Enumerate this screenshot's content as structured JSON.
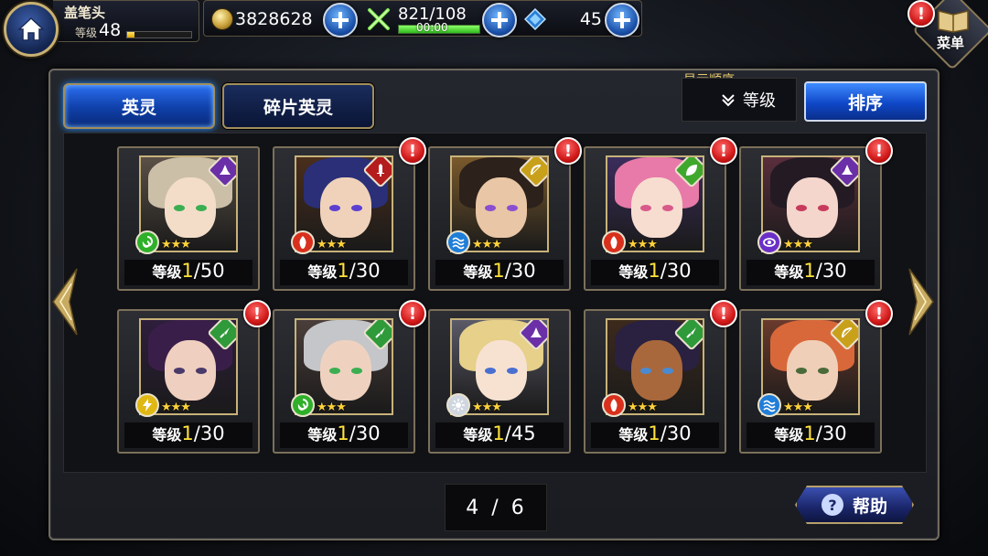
{
  "player": {
    "name": "盖笔头",
    "level_label": "等级",
    "level": "48",
    "exp_fraction": 0.12
  },
  "resources": {
    "coins": "3828628",
    "stamina": "821/108",
    "stamina_timer": "00:00",
    "stamina_fraction": 1.0,
    "gems": "45"
  },
  "menu": {
    "label": "菜单"
  },
  "tabs": [
    {
      "label": "英灵",
      "active": true
    },
    {
      "label": "碎片英灵",
      "active": false
    }
  ],
  "sort": {
    "caption": "显示顺序",
    "selected": "等级",
    "button_label": "排序"
  },
  "cards": [
    {
      "level_prefix": "等级",
      "level": "1",
      "max": "/50",
      "class_icon": "hat-icon",
      "class_color": "#6b2fa8",
      "element_icon": "wind-icon",
      "element_color": "#2fb02a",
      "stars": "★★★",
      "alert": false,
      "hair": "#cbbfa8",
      "skin": "#f3ddc9",
      "eye": "#3cae52",
      "bg": "#5a5046"
    },
    {
      "level_prefix": "等级",
      "level": "1",
      "max": "/30",
      "class_icon": "sword-icon",
      "class_color": "#b51c1c",
      "element_icon": "fire-icon",
      "element_color": "#d8301c",
      "stars": "★★★",
      "alert": true,
      "hair": "#2a2f78",
      "skin": "#f0d2bb",
      "eye": "#5b3fd1",
      "bg": "#4a2e1c"
    },
    {
      "level_prefix": "等级",
      "level": "1",
      "max": "/30",
      "class_icon": "bow-icon",
      "class_color": "#c9a01a",
      "element_icon": "water-icon",
      "element_color": "#1f7ed8",
      "stars": "★★★",
      "alert": true,
      "hair": "#2c211b",
      "skin": "#e9c6a6",
      "eye": "#8a4fd0",
      "bg": "#7a5a2c"
    },
    {
      "level_prefix": "等级",
      "level": "1",
      "max": "/30",
      "class_icon": "leaf-icon",
      "class_color": "#3fa82c",
      "element_icon": "fire-icon",
      "element_color": "#d8301c",
      "stars": "★★★",
      "alert": true,
      "hair": "#e77aa8",
      "skin": "#f7ddd0",
      "eye": "#d85a8a",
      "bg": "#3b2d5c"
    },
    {
      "level_prefix": "等级",
      "level": "1",
      "max": "/30",
      "class_icon": "hat-icon",
      "class_color": "#6b2fa8",
      "element_icon": "eye-icon",
      "element_color": "#6a2fc8",
      "stars": "★★★",
      "alert": true,
      "hair": "#231a24",
      "skin": "#f4d6cc",
      "eye": "#c83a5c",
      "bg": "#5a2e3c"
    },
    {
      "level_prefix": "等级",
      "level": "1",
      "max": "/30",
      "class_icon": "dagger-icon",
      "class_color": "#2f9a3a",
      "element_icon": "lightning-icon",
      "element_color": "#e0b814",
      "stars": "★★★",
      "alert": true,
      "hair": "#3a1e4a",
      "skin": "#efcfbf",
      "eye": "#4a3a6a",
      "bg": "#2e1e3c"
    },
    {
      "level_prefix": "等级",
      "level": "1",
      "max": "/30",
      "class_icon": "dagger-icon",
      "class_color": "#2f9a3a",
      "element_icon": "wind-icon",
      "element_color": "#2fb02a",
      "stars": "★★★",
      "alert": true,
      "hair": "#c4c6c9",
      "skin": "#eed2bf",
      "eye": "#3cae52",
      "bg": "#4a3e3a"
    },
    {
      "level_prefix": "等级",
      "level": "1",
      "max": "/45",
      "class_icon": "hat-icon",
      "class_color": "#6b2fa8",
      "element_icon": "light-icon",
      "element_color": "#cfd6e0",
      "stars": "★★★",
      "alert": false,
      "hair": "#e6d08a",
      "skin": "#f7e2d2",
      "eye": "#4a6fd0",
      "bg": "#5a5a68"
    },
    {
      "level_prefix": "等级",
      "level": "1",
      "max": "/30",
      "class_icon": "dagger-icon",
      "class_color": "#2f9a3a",
      "element_icon": "fire-icon",
      "element_color": "#d8301c",
      "stars": "★★★",
      "alert": true,
      "hair": "#2a2140",
      "skin": "#a8683c",
      "eye": "#4a8ad0",
      "bg": "#3c2a1c"
    },
    {
      "level_prefix": "等级",
      "level": "1",
      "max": "/30",
      "class_icon": "bow-icon",
      "class_color": "#c9a01a",
      "element_icon": "water-icon",
      "element_color": "#1f7ed8",
      "stars": "★★★",
      "alert": true,
      "hair": "#d8683a",
      "skin": "#f0cfb8",
      "eye": "#4a6a3a",
      "bg": "#6a3a2c"
    }
  ],
  "pager": {
    "current": "4",
    "separator": "/",
    "total": "6"
  },
  "help": {
    "label": "帮助",
    "icon_text": "?"
  },
  "alert_text": "!"
}
